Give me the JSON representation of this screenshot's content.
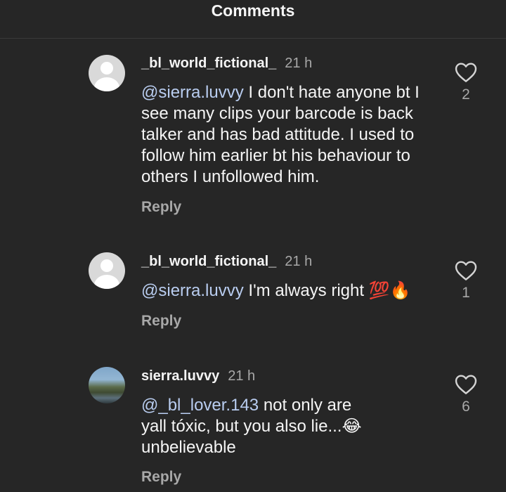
{
  "header": {
    "title": "Comments"
  },
  "icons": {
    "heart": "heart-outline-icon",
    "avatar": "default-avatar-icon"
  },
  "colors": {
    "background": "#262626",
    "text": "#f5f5f5",
    "muted": "#a8a8a8",
    "mention": "#b9cdf0"
  },
  "comments": [
    {
      "username": "_bl_world_fictional_",
      "time": "21 h",
      "mention": "@sierra.luvvy",
      "text": " I don't hate anyone bt I see many clips your barcode is back talker and has bad attitude. I used to follow him earlier bt his behaviour to others I unfollowed him.",
      "reply_label": "Reply",
      "likes": "2"
    },
    {
      "username": "_bl_world_fictional_",
      "time": "21 h",
      "mention": "@sierra.luvvy",
      "text": " I'm always right 💯🔥",
      "reply_label": "Reply",
      "likes": "1"
    },
    {
      "username": "sierra.luvvy",
      "time": "21 h",
      "mention": "@_bl_lover.143",
      "text": " not only are yall tóxic, but you also lie...😂 unbelievable",
      "reply_label": "Reply",
      "likes": "6"
    }
  ]
}
